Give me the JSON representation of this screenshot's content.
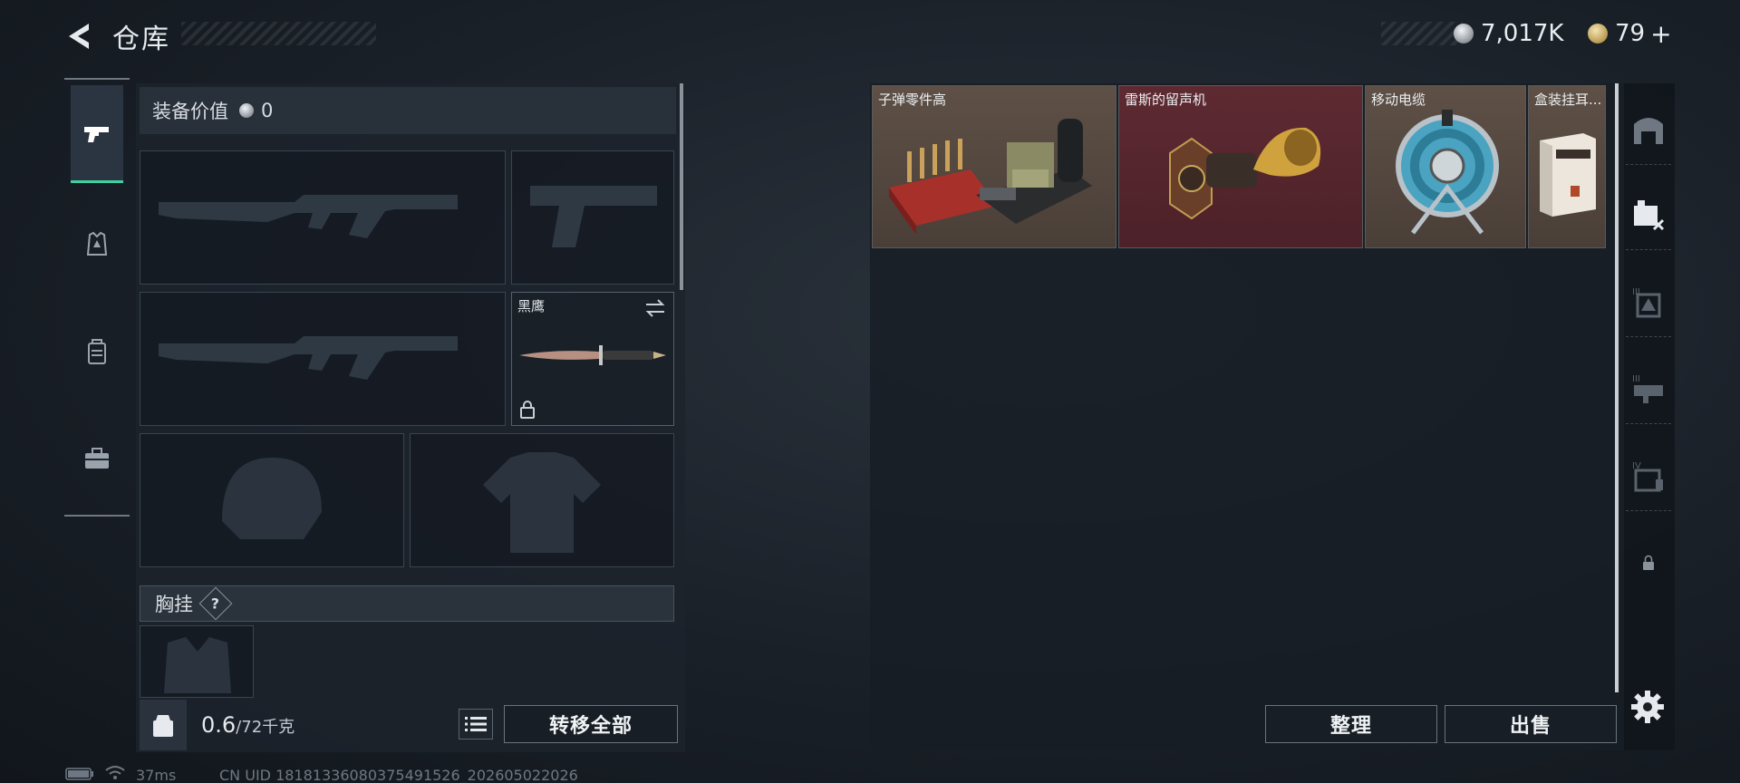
{
  "header": {
    "title": "仓库",
    "currency_silver": "7,017K",
    "currency_gold": "79"
  },
  "equipment": {
    "value_label": "装备价值",
    "value": "0",
    "melee_name": "黑鹰",
    "chest_label": "胸挂",
    "help_label": "?",
    "weight_current": "0.6",
    "weight_max": "/72千克",
    "weight_icon_text": "KG",
    "transfer_all": "转移全部"
  },
  "storage": {
    "items": [
      {
        "name": "子弹零件高",
        "rarity_color": "#6b5a4c"
      },
      {
        "name": "雷斯的留声机",
        "rarity_color": "#5a2b32"
      },
      {
        "name": "移动电缆",
        "rarity_color": "#6b5a4c"
      },
      {
        "name": "盒装挂耳...",
        "rarity_color": "#6b5a4c"
      }
    ],
    "sort": "整理",
    "sell": "出售"
  },
  "categories": [
    "all",
    "bag",
    "III-armor",
    "III-rig",
    "IV-case",
    "locked"
  ],
  "status": {
    "ping": "37ms",
    "uid": "CN UID 18181336080375491526_202605022026"
  },
  "colors": {
    "accent": "#3fd0a0",
    "panel": "#1c232b"
  }
}
